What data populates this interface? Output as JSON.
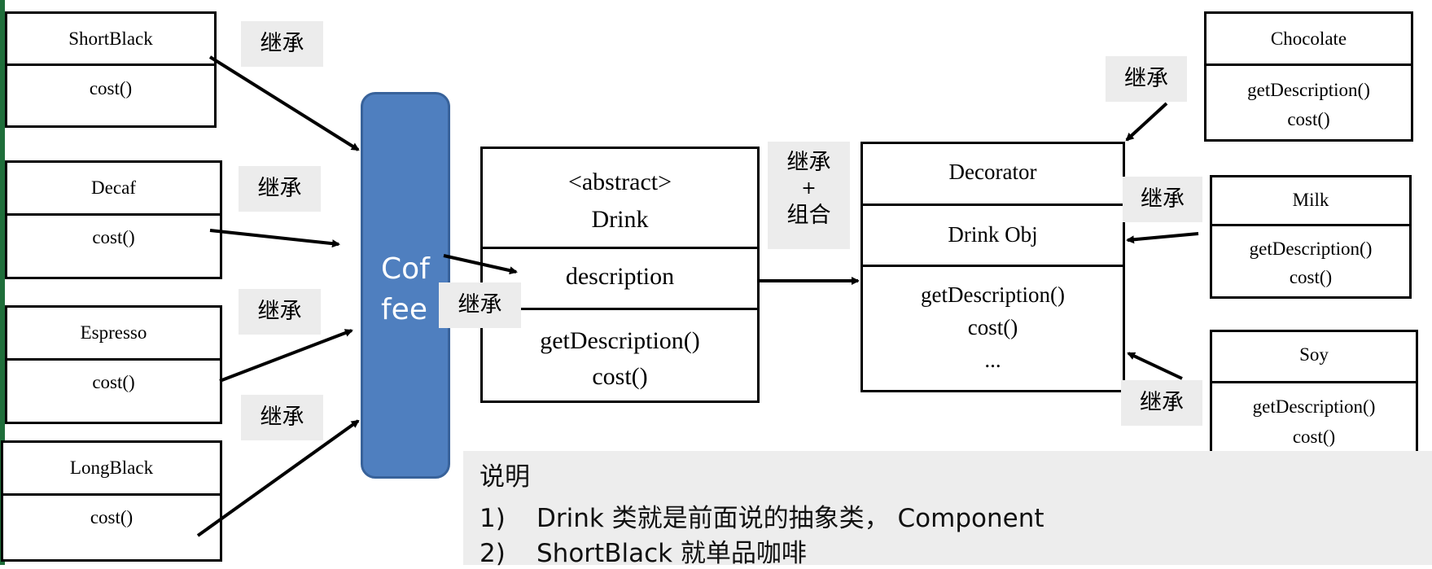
{
  "classes": {
    "shortblack": {
      "name": "ShortBlack",
      "method": "cost()"
    },
    "decaf": {
      "name": "Decaf",
      "method": "cost()"
    },
    "espresso": {
      "name": "Espresso",
      "method": "cost()"
    },
    "longblack": {
      "name": "LongBlack",
      "method": "cost()"
    },
    "drink": {
      "stereotype": "<abstract>",
      "name": "Drink",
      "field": "description",
      "method1": "getDescription()",
      "method2": "cost()"
    },
    "decorator": {
      "name": "Decorator",
      "field": "Drink Obj",
      "method1": "getDescription()",
      "method2": "cost()",
      "more": "..."
    },
    "chocolate": {
      "name": "Chocolate",
      "method1": "getDescription()",
      "method2": "cost()"
    },
    "milk": {
      "name": "Milk",
      "method1": "getDescription()",
      "method2": "cost()"
    },
    "soy": {
      "name": "Soy",
      "method1": "getDescription()",
      "method2": "cost()"
    }
  },
  "coffee": {
    "line1": "Cof",
    "line2": "fee"
  },
  "labels": {
    "inherit": "继承",
    "combo_line1": "继承",
    "combo_plus": "+",
    "combo_line2": "组合"
  },
  "notes": {
    "heading": "说明",
    "items": [
      {
        "num": "1)",
        "text": "Drink 类就是前面说的抽象类， Component"
      },
      {
        "num": "2)",
        "text": "ShortBlack 就单品咖啡"
      }
    ]
  },
  "colors": {
    "coffee_fill": "#4f7fbf",
    "tag_bg": "#ececec",
    "notes_bg": "#ededed"
  }
}
